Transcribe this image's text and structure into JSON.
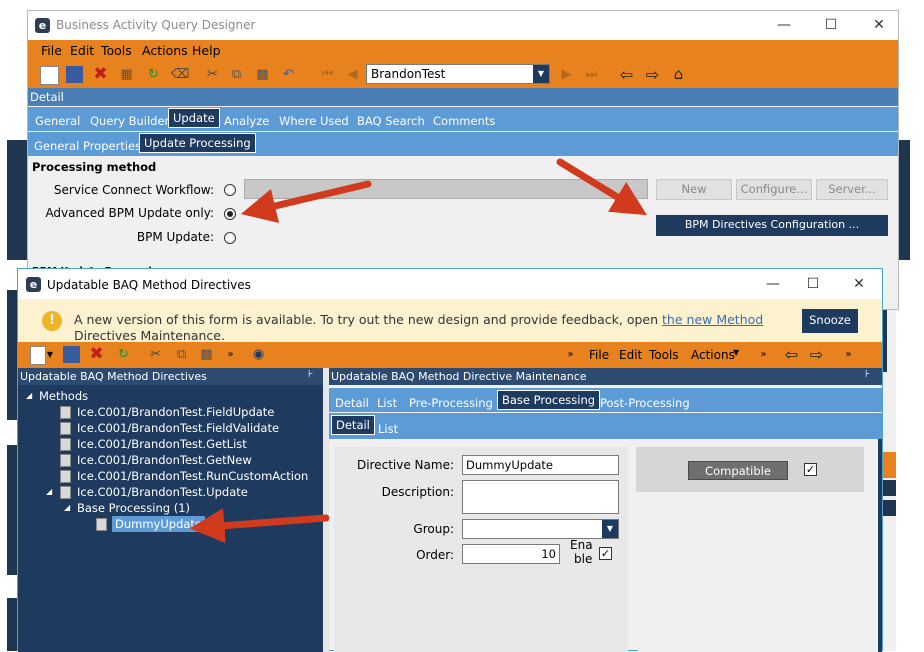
{
  "main_window": {
    "title": "Business Activity Query Designer",
    "menu": [
      "File",
      "Edit",
      "Tools",
      "Actions",
      "Help"
    ],
    "query_combo": "BrandonTest",
    "detail_label": "Detail",
    "tabs": [
      "General",
      "Query Builder",
      "Update",
      "Analyze",
      "Where Used",
      "BAQ Search",
      "Comments"
    ],
    "active_tab": "Update",
    "subtabs": [
      "General Properties",
      "Update Processing"
    ],
    "active_subtab": "Update Processing",
    "section_title": "Processing method",
    "options": [
      {
        "label": "Service Connect Workflow:",
        "selected": false
      },
      {
        "label": "Advanced BPM Update only:",
        "selected": true
      },
      {
        "label": "BPM Update:",
        "selected": false
      }
    ],
    "buttons": {
      "new": "New",
      "configure": "Configure...",
      "server": "Server..."
    },
    "bpm_directives_button": "BPM Directives Configuration ...",
    "partial_label": "BPM Update Processing"
  },
  "dialog": {
    "title": "Updatable BAQ Method Directives",
    "notice_text": "A new version of this form is available. To try out the new design and provide feedback, open",
    "notice_link": "the new Method",
    "notice_text2": "Directives Maintenance.",
    "snooze_label": "Snooze",
    "menu": [
      "File",
      "Edit",
      "Tools",
      "Actions"
    ],
    "left_panel_title": "Updatable BAQ Method Directives",
    "right_panel_title": "Updatable BAQ Method Directive Maintenance",
    "tree": {
      "root": "Methods",
      "methods": [
        "Ice.C001/BrandonTest.FieldUpdate",
        "Ice.C001/BrandonTest.FieldValidate",
        "Ice.C001/BrandonTest.GetList",
        "Ice.C001/BrandonTest.GetNew",
        "Ice.C001/BrandonTest.RunCustomAction",
        "Ice.C001/BrandonTest.Update"
      ],
      "group": "Base Processing (1)",
      "selected_leaf": "DummyUpdate"
    },
    "tabs": [
      "Detail",
      "List",
      "Pre-Processing",
      "Base Processing",
      "Post-Processing"
    ],
    "active_tab": "Base Processing",
    "subtabs": [
      "Detail",
      "List"
    ],
    "active_subtab": "Detail",
    "form": {
      "directive_name_label": "Directive Name:",
      "directive_name_value": "DummyUpdate",
      "description_label": "Description:",
      "description_value": "",
      "group_label": "Group:",
      "group_value": "",
      "order_label": "Order:",
      "order_value": "10",
      "enable_label_1": "Ena",
      "enable_label_2": "ble",
      "enabled": true
    },
    "compatible_label": "Compatible",
    "compatible_checked": true
  },
  "colors": {
    "accent_orange": "#e8821f",
    "navy": "#1f3a5f",
    "tab_blue": "#5c9bd6",
    "annotation_red": "#d23a1e"
  }
}
